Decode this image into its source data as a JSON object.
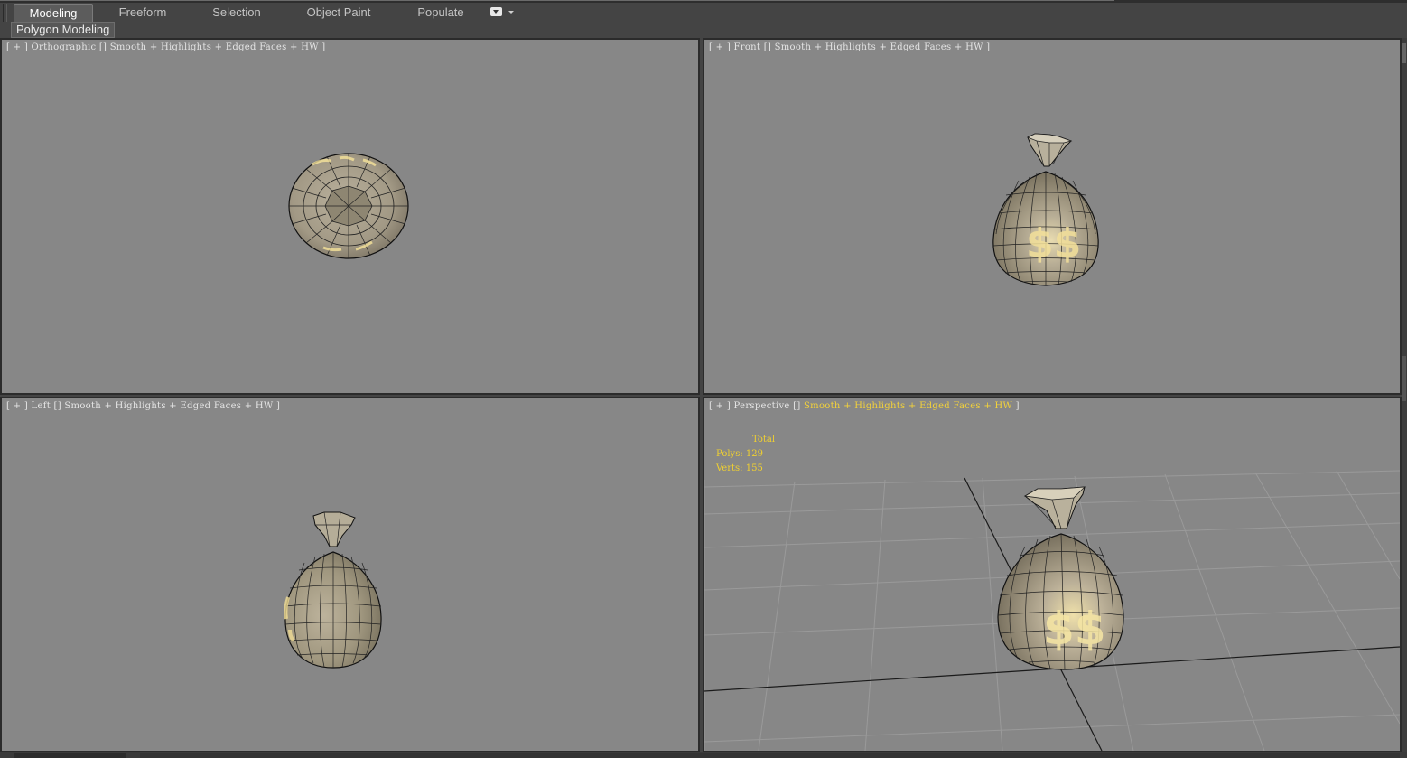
{
  "ribbon": {
    "tabs": [
      {
        "label": "Modeling",
        "active": true
      },
      {
        "label": "Freeform",
        "active": false
      },
      {
        "label": "Selection",
        "active": false
      },
      {
        "label": "Object Paint",
        "active": false
      },
      {
        "label": "Populate",
        "active": false
      }
    ],
    "subtab_label": "Polygon Modeling"
  },
  "viewports": {
    "top_left": {
      "bracket_open": "[ + ] ",
      "view": "Orthographic",
      "sep": " [] ",
      "shading": "Smooth + Highlights + Edged Faces + HW",
      "bracket_close": " ]"
    },
    "top_right": {
      "bracket_open": "[ + ] ",
      "view": "Front",
      "sep": " [] ",
      "shading": "Smooth + Highlights + Edged Faces + HW",
      "bracket_close": " ]"
    },
    "bottom_left": {
      "bracket_open": "[ + ] ",
      "view": "Left",
      "sep": " [] ",
      "shading": "Smooth + Highlights + Edged Faces + HW",
      "bracket_close": " ]"
    },
    "bottom_right": {
      "bracket_open": "[ + ] ",
      "view": "Perspective",
      "sep": " [] ",
      "shading": "Smooth + Highlights + Edged Faces + HW",
      "bracket_close": " ]",
      "stats": {
        "total_label": "Total",
        "polys_label": "Polys:",
        "polys_value": "129",
        "verts_label": "Verts:",
        "verts_value": "155"
      }
    }
  },
  "colors": {
    "ui_background": "#444444",
    "viewport_background": "#878787",
    "stats_text": "#f0d030",
    "active_shading_text": "#f3d23a"
  },
  "icons": {
    "ribbon_dropdown": "ribbon-options-dropdown-icon",
    "model": "money-bag-model"
  }
}
